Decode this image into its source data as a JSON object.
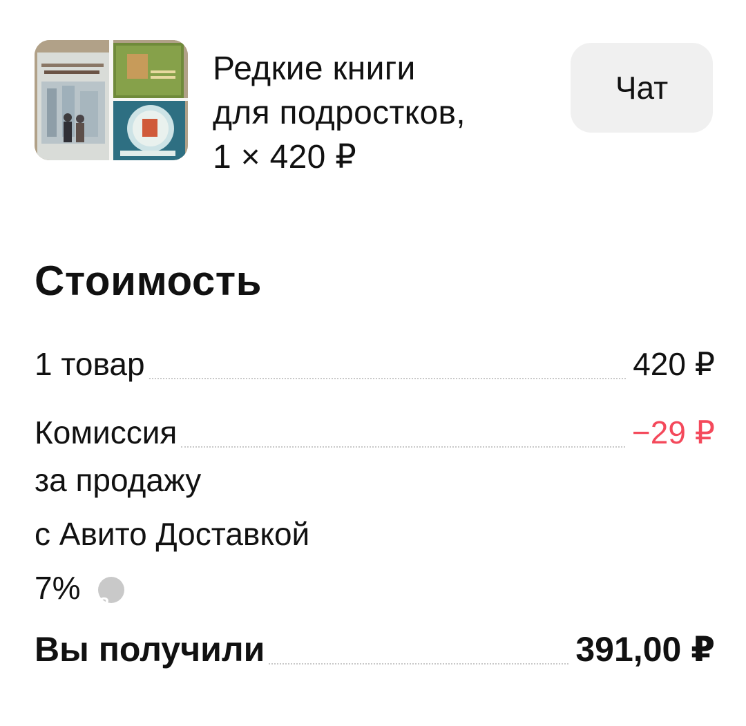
{
  "product": {
    "thumbnail": "book-collage-thumbnail",
    "title_lines": [
      "Редкие книги",
      "для подростков,",
      "1 × 420 ₽"
    ],
    "chat_label": "Чат"
  },
  "cost": {
    "title": "Стоимость",
    "items": {
      "label": "1 товар",
      "value": "420 ₽"
    },
    "commission": {
      "label": "Комиссия",
      "label_rest": [
        "за продажу",
        "с Авито Доставкой"
      ],
      "percent": "7%",
      "value": "−29 ₽",
      "help_icon": "question-circle-icon"
    },
    "total": {
      "label": "Вы получили",
      "value": "391,00 ₽"
    }
  },
  "colors": {
    "negative": "#f4495b",
    "chat_bg": "#f0f0f0",
    "help_icon": "#c9c9c9"
  }
}
